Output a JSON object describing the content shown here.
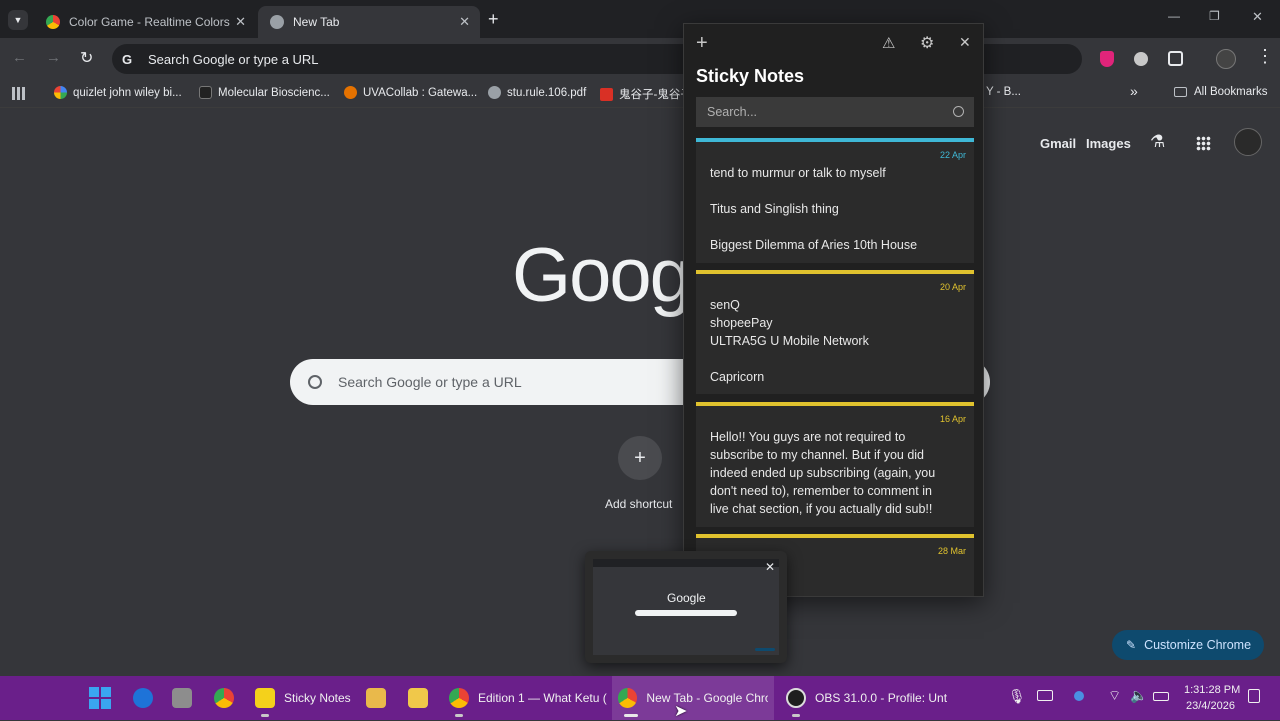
{
  "tabs": [
    {
      "title": "Color Game - Realtime Colors",
      "close": "✕"
    },
    {
      "title": "New Tab",
      "close": "✕"
    }
  ],
  "new_tab_symbol": "+",
  "window_controls": {
    "minimize": "—",
    "maximize": "❐",
    "close": "✕"
  },
  "omnibox": {
    "text": "Search Google or type a URL",
    "google_g": "G"
  },
  "bookmarks": {
    "items": [
      "quizlet john wiley bi...",
      "Molecular Bioscienc...",
      "UVACollab : Gatewa...",
      "stu.rule.106.pdf",
      "鬼谷子-鬼谷子"
    ],
    "partial_right": "Y - B...",
    "overflow": "»",
    "all_bookmarks": "All Bookmarks"
  },
  "ntp": {
    "links": [
      "Gmail",
      "Images"
    ],
    "logo": "Goog",
    "search_placeholder": "Search Google or type a URL",
    "add_shortcut_label": "Add shortcut",
    "add_shortcut_symbol": "+",
    "customize_label": "Customize Chrome"
  },
  "sticky_notes": {
    "title": "Sticky Notes",
    "search_placeholder": "Search...",
    "notes": [
      {
        "date": "22 Apr",
        "color": "#3fb8d6",
        "lines": [
          "tend to murmur or talk to myself",
          "",
          "Titus and Singlish thing",
          "",
          "Biggest Dilemma of Aries 10th House"
        ]
      },
      {
        "date": "20 Apr",
        "color": "#e0c22e",
        "lines": [
          "senQ",
          "shopeePay",
          "ULTRA5G U Mobile Network",
          "",
          "Capricorn"
        ]
      },
      {
        "date": "16 Apr",
        "color": "#e0c22e",
        "lines": [
          "Hello!! You guys are not required to",
          "subscribe to my channel. But if you did",
          "indeed ended up subscribing (again, you",
          "don't need to), remember to comment in",
          "live chat section, if you actually did sub!!"
        ]
      },
      {
        "date": "28 Mar",
        "color": "#e0c22e",
        "lines": []
      }
    ]
  },
  "thumbnail": {
    "logo": "Google",
    "close": "✕"
  },
  "taskbar": {
    "items": [
      "Sticky Notes",
      "Edition 1 — What Ketu (",
      "New Tab - Google Chro",
      "OBS 31.0.0 - Profile: Unt"
    ],
    "time": "1:31:28 PM",
    "date": "23/4/2026"
  },
  "colors": {
    "accent": "#8ab4f8",
    "taskbar": "#6a1f8a",
    "customize_btn": "#0e4a6e"
  }
}
